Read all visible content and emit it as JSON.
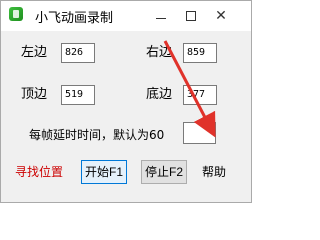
{
  "window": {
    "title": "小飞动画录制"
  },
  "fields": {
    "left": {
      "label": "左边",
      "value": "826"
    },
    "right": {
      "label": "右边",
      "value": "859"
    },
    "top": {
      "label": "顶边",
      "value": "519"
    },
    "bottom": {
      "label": "底边",
      "value": "377"
    },
    "delay": {
      "label": "每帧延时时间，默认为60",
      "value": ""
    }
  },
  "buttons": {
    "find_position": "寻找位置",
    "start": "开始F1",
    "stop": "停止F2",
    "help": "帮助"
  },
  "colors": {
    "arrow": "#e0322a",
    "find_position_text": "#cc0000"
  }
}
